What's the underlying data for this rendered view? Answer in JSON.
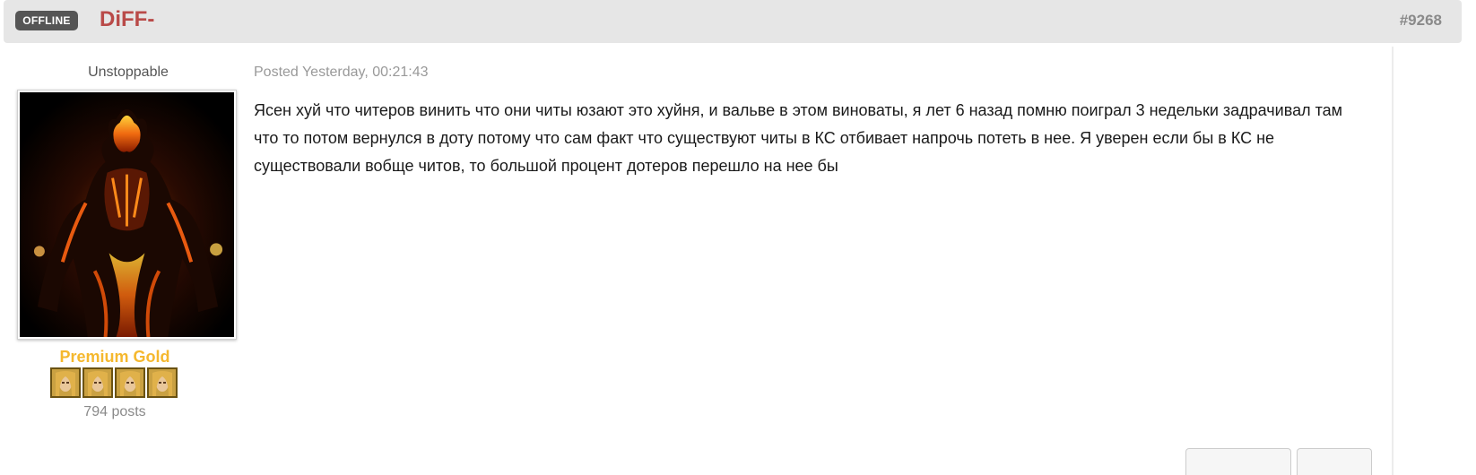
{
  "header": {
    "status_badge": "OFFLINE",
    "author": "DiFF-",
    "post_number": "#9268"
  },
  "author_panel": {
    "rank_title": "Unstoppable",
    "group": "Premium Gold",
    "rank_icons": [
      "hero-rank-icon",
      "hero-rank-icon",
      "hero-rank-icon",
      "hero-rank-icon"
    ],
    "post_count": "794 posts"
  },
  "post": {
    "posted": "Posted Yesterday, 00:21:43",
    "body": "Ясен хуй что читеров винить что они читы юзают это хуйня, и вальве в этом виноваты, я лет 6 назад помню поиграл 3 недельки задрачивал там что то потом вернулся в доту потому что сам факт что существуют читы в КС отбивает напрочь потеть в нее. Я уверен если бы в КС не существовали вобще читов, то большой процент дотеров перешло на нее бы"
  },
  "colors": {
    "author": "#b94a48",
    "group": "#f5b82e",
    "header_bg": "#e6e6e6",
    "badge_bg": "#555555"
  }
}
